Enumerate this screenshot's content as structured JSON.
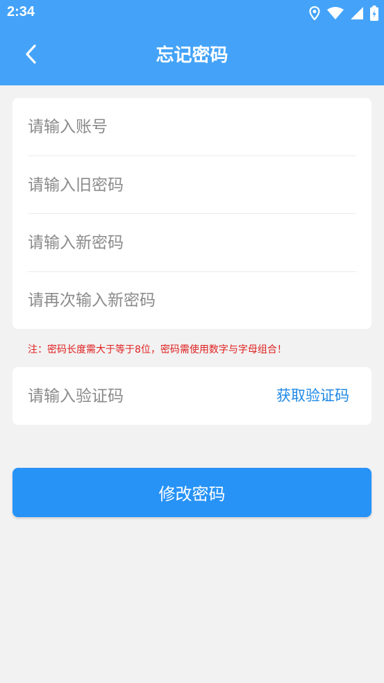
{
  "status_bar": {
    "time": "2:34",
    "icons": [
      "location-icon",
      "wifi-icon",
      "signal-icon",
      "battery-icon"
    ]
  },
  "nav": {
    "title": "忘记密码",
    "back_icon": "chevron-left-icon"
  },
  "form": {
    "account_placeholder": "请输入账号",
    "old_password_placeholder": "请输入旧密码",
    "new_password_placeholder": "请输入新密码",
    "confirm_password_placeholder": "请再次输入新密码"
  },
  "note": "注：密码长度需大于等于8位，密码需使用数字与字母组合！",
  "verify": {
    "code_placeholder": "请输入验证码",
    "get_code_label": "获取验证码"
  },
  "submit_label": "修改密码",
  "colors": {
    "header_bg": "#44a3f8",
    "page_bg": "#f2f2f2",
    "button_bg": "#2793f7",
    "link": "#1e88e5",
    "note": "#e02020"
  }
}
